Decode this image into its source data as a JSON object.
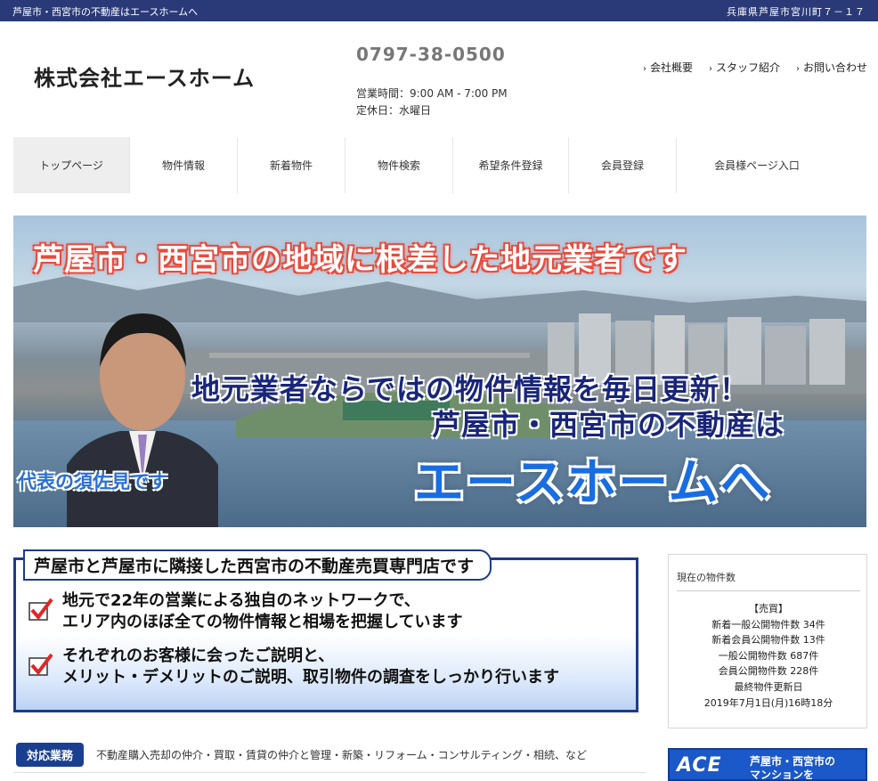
{
  "topbar": {
    "left": "芦屋市・西宮市の不動産はエースホームへ",
    "right": "兵庫県芦屋市宮川町７－１７"
  },
  "header": {
    "logo": "株式会社エースホーム",
    "phone": "0797-38-0500",
    "hours": "営業時間：9:00 AM - 7:00 PM",
    "closed": "定休日：水曜日",
    "links": [
      "会社概要",
      "スタッフ紹介",
      "お問い合わせ"
    ]
  },
  "nav": {
    "items": [
      "トップページ",
      "物件情報",
      "新着物件",
      "物件検索",
      "希望条件登録",
      "会員登録",
      "会員様ページ入口"
    ]
  },
  "hero": {
    "headline": "芦屋市・西宮市の地域に根差した地元業者です",
    "line1": "地元業者ならではの物件情報を毎日更新！",
    "line2": "芦屋市・西宮市の不動産は",
    "brand": "エースホームへ",
    "caption": "代表の須佐見です"
  },
  "feature": {
    "title": "芦屋市と芦屋市に隣接した西宮市の不動産売買専門店です",
    "points": [
      {
        "l1": "地元で22年の営業による独自のネットワークで、",
        "l2": "エリア内のほぼ全ての物件情報と相場を把握しています"
      },
      {
        "l1": "それぞれのお客様に会ったご説明と、",
        "l2": "メリット・デメリットのご説明、取引物件の調査をしっかり行います"
      }
    ]
  },
  "business": {
    "label": "対応業務",
    "text": "不動産購入売却の仲介・買取・賃貸の仲介と管理・新築・リフォーム・コンサルティング・相続、など"
  },
  "sidebar": {
    "heading": "現在の物件数",
    "lines": [
      "【売買】",
      "新着一般公開物件数 34件",
      "新着会員公開物件数 13件",
      "一般公開物件数 687件",
      "会員公開物件数 228件",
      "最終物件更新日",
      "2019年7月1日(月)16時18分"
    ]
  },
  "banner": {
    "logo": "ACE",
    "text1": "芦屋市・西宮市の",
    "text2": "マンションを"
  },
  "colors": {
    "topbar": "#2a3a78",
    "accent": "#1d3b8c",
    "brand_blue": "#1a6de0"
  }
}
